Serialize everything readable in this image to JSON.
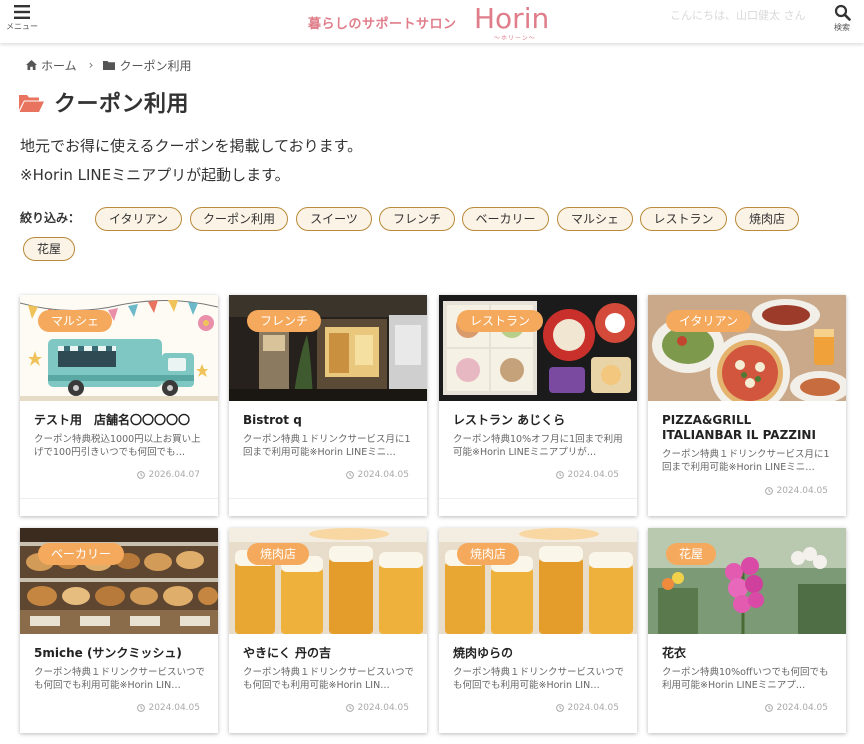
{
  "header": {
    "menu_label": "メニュー",
    "search_label": "検索",
    "tagline": "暮らしのサポートサロン",
    "brand": "Horin",
    "brand_sub": "〜ホリーン〜",
    "greeting": "こんにちは、山口健太 さん"
  },
  "breadcrumb": {
    "home": "ホーム",
    "current": "クーポン利用"
  },
  "page": {
    "title": "クーポン利用",
    "intro_line1": "地元でお得に使えるクーポンを掲載しております。",
    "intro_line2": "※Horin LINEミニアプリが起動します。"
  },
  "filters": {
    "label": "絞り込み：",
    "tags": [
      "イタリアン",
      "クーポン利用",
      "スイーツ",
      "フレンチ",
      "ベーカリー",
      "マルシェ",
      "レストラン",
      "焼肉店",
      "花屋"
    ]
  },
  "cards": [
    {
      "category": "マルシェ",
      "title": "テスト用　店舗名〇〇〇〇〇",
      "desc": "クーポン特典税込1000円以上お買い上げで100円引きいつでも何回でも…",
      "date": "2026.04.07"
    },
    {
      "category": "フレンチ",
      "title": "Bistrot q",
      "desc": "クーポン特典１ドリンクサービス月に1回まで利用可能※Horin LINEミニ…",
      "date": "2024.04.05"
    },
    {
      "category": "レストラン",
      "title": "レストラン あじくら",
      "desc": "クーポン特典10%オフ月に1回まで利用可能※Horin LINEミニアプリが…",
      "date": "2024.04.05"
    },
    {
      "category": "イタリアン",
      "title": "PIZZA&GRILL ITALIANBAR IL PAZZINI",
      "desc": "クーポン特典１ドリンクサービス月に1回まで利用可能※Horin LINEミニ…",
      "date": "2024.04.05"
    },
    {
      "category": "ベーカリー",
      "title": "5miche (サンクミッシュ)",
      "desc": "クーポン特典１ドリンクサービスいつでも何回でも利用可能※Horin LIN…",
      "date": "2024.04.05"
    },
    {
      "category": "焼肉店",
      "title": "やきにく 丹の吉",
      "desc": "クーポン特典１ドリンクサービスいつでも何回でも利用可能※Horin LIN…",
      "date": "2024.04.05"
    },
    {
      "category": "焼肉店",
      "title": "焼肉ゆらの",
      "desc": "クーポン特典１ドリンクサービスいつでも何回でも利用可能※Horin LIN…",
      "date": "2024.04.05"
    },
    {
      "category": "花屋",
      "title": "花衣",
      "desc": "クーポン特典10%offいつでも何回でも利用可能※Horin LINEミニアプ…",
      "date": "2024.04.05"
    }
  ],
  "colors": {
    "brand_pink": "#e07d8a",
    "badge_orange": "#f5a95c",
    "chip_border": "#b98a3a",
    "chip_bg": "#fbf3e6",
    "folder_icon": "#e8735e"
  },
  "icons": {
    "menu": "hamburger-icon",
    "search": "search-icon",
    "home": "home-icon",
    "folder": "folder-icon",
    "title": "folder-open-icon",
    "date": "clock-icon"
  }
}
